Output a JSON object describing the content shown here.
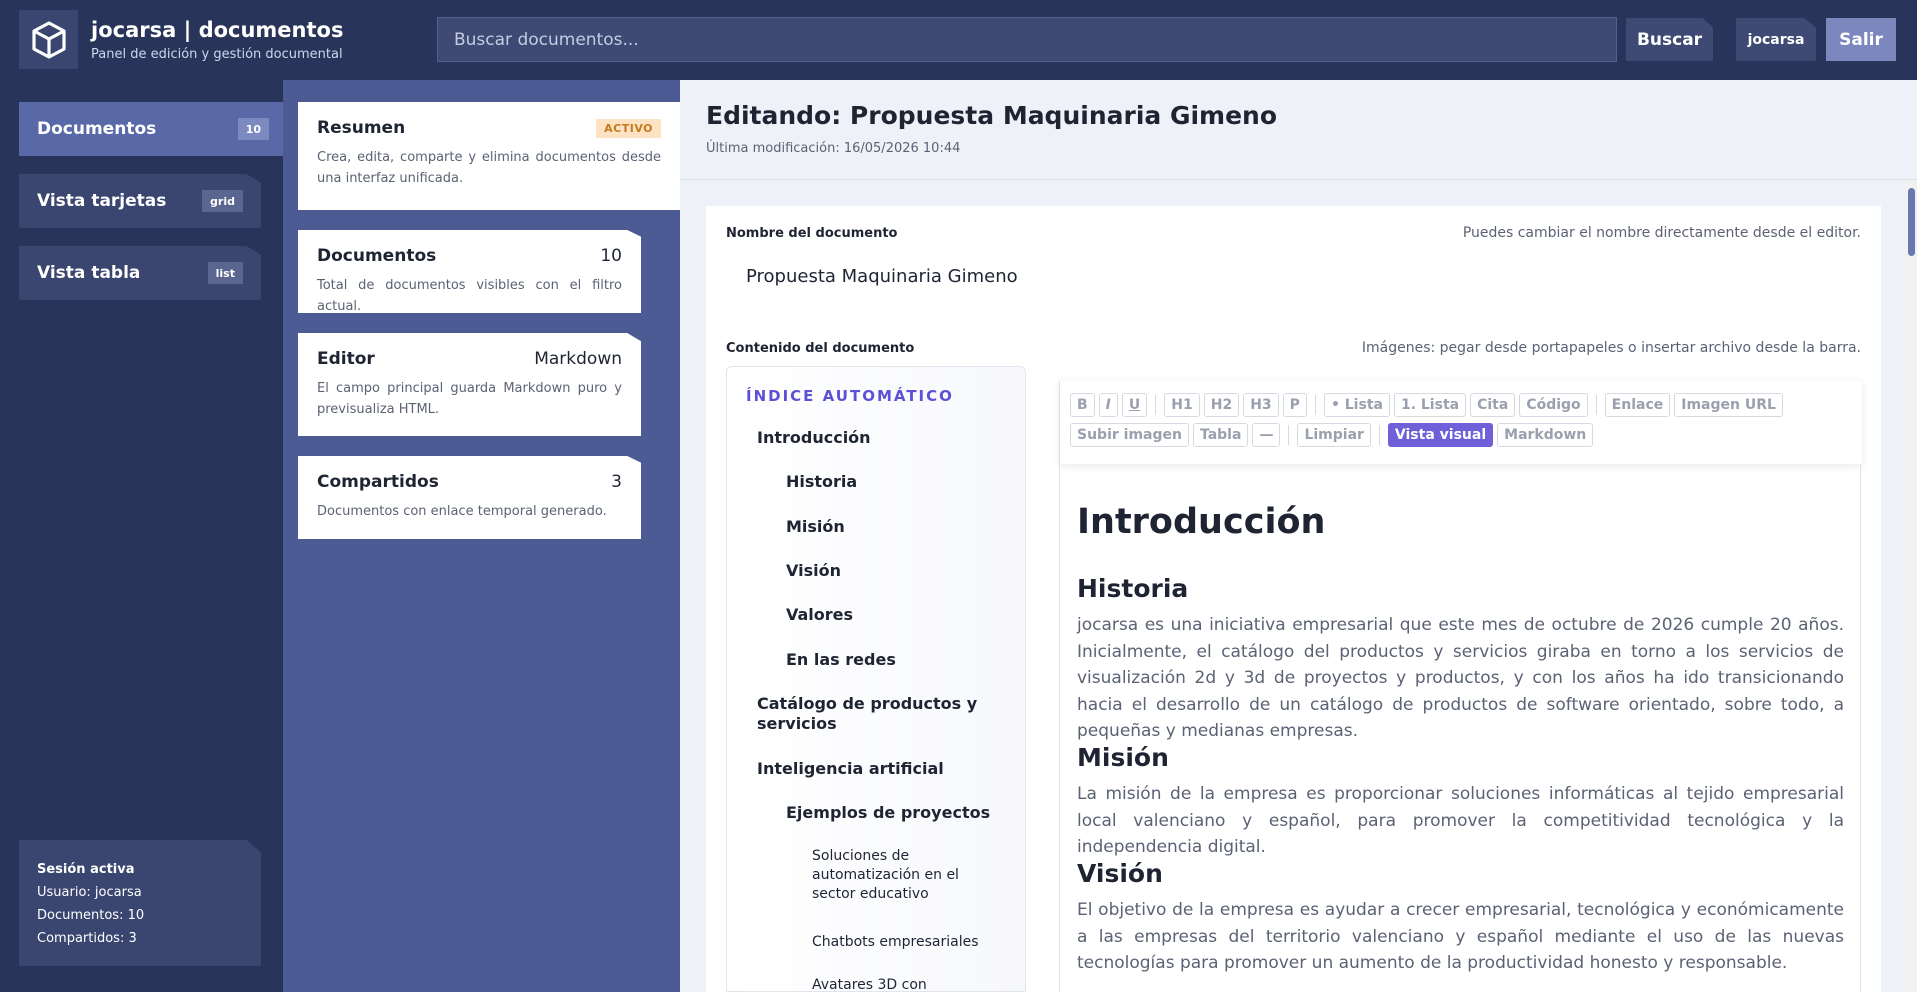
{
  "header": {
    "brand_title": "jocarsa | documentos",
    "brand_subtitle": "Panel de edición y gestión documental",
    "search_placeholder": "Buscar documentos...",
    "search_button": "Buscar",
    "user_label": "jocarsa",
    "logout_button": "Salir",
    "logo_icon": "cube-icon"
  },
  "sidebar": {
    "items": [
      {
        "label": "Documentos",
        "badge": "10",
        "active": true
      },
      {
        "label": "Vista tarjetas",
        "badge": "grid"
      },
      {
        "label": "Vista tabla",
        "badge": "list"
      }
    ],
    "session": {
      "title": "Sesión activa",
      "user": "Usuario: jocarsa",
      "documents": "Documentos: 10",
      "shared": "Compartidos: 3"
    }
  },
  "summary_cards": [
    {
      "title": "Resumen",
      "badge": "ACTIVO",
      "value": "",
      "description": "Crea, edita, comparte y elimina documentos desde una interfaz unificada."
    },
    {
      "title": "Documentos",
      "value": "10",
      "description": "Total de documentos visibles con el filtro actual."
    },
    {
      "title": "Editor",
      "value": "Markdown",
      "description": "El campo principal guarda Markdown puro y previsualiza HTML."
    },
    {
      "title": "Compartidos",
      "value": "3",
      "description": "Documentos con enlace temporal generado."
    }
  ],
  "main": {
    "title": "Editando: Propuesta Maquinaria Gimeno",
    "last_modified": "Última modificación: 16/05/2026 10:44",
    "name_label": "Nombre del documento",
    "name_hint": "Puedes cambiar el nombre directamente desde el editor.",
    "name_value": "Propuesta Maquinaria Gimeno",
    "content_label": "Contenido del documento",
    "content_hint": "Imágenes: pegar desde portapapeles o insertar archivo desde la barra."
  },
  "toc": {
    "title": "ÍNDICE AUTOMÁTICO",
    "items": [
      "Introducción",
      "Historia",
      "Misión",
      "Visión",
      "Valores",
      "En las redes",
      "Catálogo de productos y servicios",
      "Inteligencia artificial",
      "Ejemplos de proyectos",
      "Soluciones de automatización en el sector educativo",
      "Chatbots empresariales",
      "Avatares 3D con"
    ]
  },
  "toolbar": {
    "row1": [
      "B",
      "I",
      "U",
      "H1",
      "H2",
      "H3",
      "P",
      "• Lista",
      "1. Lista",
      "Cita",
      "Código",
      "Enlace",
      "Imagen URL"
    ],
    "row2": [
      "Subir imagen",
      "Tabla",
      "—",
      "Limpiar",
      "Vista visual",
      "Markdown"
    ]
  },
  "document": {
    "h1": "Introducción",
    "sections": [
      {
        "heading": "Historia",
        "text": "jocarsa es una iniciativa empresarial que este mes de octubre de 2026 cumple 20 años. Inicialmente, el catálogo del productos y servicios giraba en torno a los servicios de visualización 2d y 3d de proyectos y productos, y con los años ha ido transicionando hacia el desarrollo de un catálogo de productos de software orientado, sobre todo, a pequeñas y medianas empresas."
      },
      {
        "heading": "Misión",
        "text": "La misión de la empresa es proporcionar soluciones informáticas al tejido empresarial local valenciano y español, para promover la competitividad tecnológica y la independencia digital."
      },
      {
        "heading": "Visión",
        "text": "El objetivo de la empresa es ayudar a crecer empresarial, tecnológica y económicamente a las empresas del territorio valenciano y español mediante el uso de las nuevas tecnologías para promover un aumento de la productividad honesto y responsable."
      }
    ]
  }
}
